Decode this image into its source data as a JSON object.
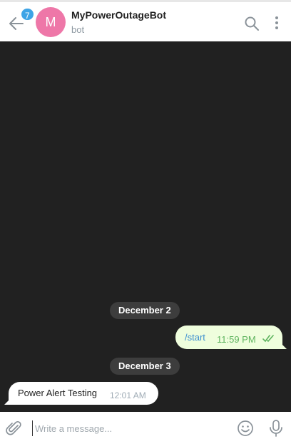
{
  "header": {
    "unread_count": "7",
    "avatar_letter": "M",
    "title": "MyPowerOutageBot",
    "subtitle": "bot",
    "icons": {
      "back": "back-arrow-icon",
      "search": "search-icon",
      "more": "more-vertical-icon"
    }
  },
  "chat": {
    "dates": [
      "December 2",
      "December 3"
    ],
    "messages": [
      {
        "direction": "outgoing",
        "text": "/start",
        "time": "11:59 PM",
        "status": "read",
        "status_icon": "double-check-icon"
      },
      {
        "direction": "incoming",
        "text": "Power Alert Testing",
        "time": "12:01 AM"
      }
    ]
  },
  "composer": {
    "placeholder": "Write a message...",
    "value": "",
    "icons": {
      "attach": "paperclip-icon",
      "emoji": "emoji-icon",
      "mic": "microphone-icon"
    }
  },
  "colors": {
    "accent": "#3ea4e6",
    "avatar": "#ee77a8",
    "chat_background": "#212121",
    "outgoing_bubble": "#effedd",
    "incoming_bubble": "#ffffff",
    "outgoing_time": "#5fb45f"
  }
}
